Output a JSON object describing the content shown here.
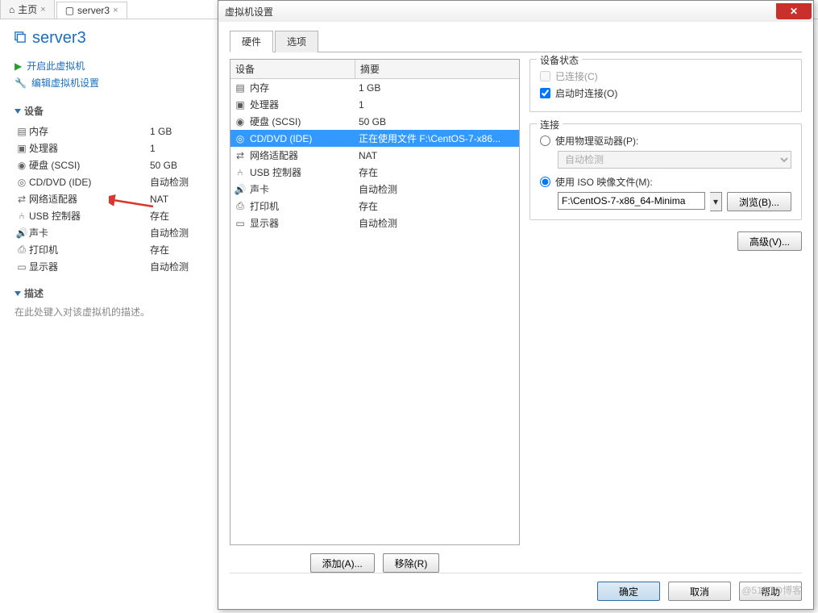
{
  "topTabs": [
    {
      "label": "主页",
      "icon": "home"
    },
    {
      "label": "server3",
      "icon": "vm",
      "active": true
    }
  ],
  "vm": {
    "name": "server3",
    "actions": {
      "start": "开启此虚拟机",
      "edit": "编辑虚拟机设置"
    }
  },
  "leftSections": {
    "devicesTitle": "设备",
    "devices": [
      {
        "name": "内存",
        "value": "1 GB",
        "icon": "memory"
      },
      {
        "name": "处理器",
        "value": "1",
        "icon": "cpu"
      },
      {
        "name": "硬盘 (SCSI)",
        "value": "50 GB",
        "icon": "disk"
      },
      {
        "name": "CD/DVD (IDE)",
        "value": "自动检测",
        "icon": "cd"
      },
      {
        "name": "网络适配器",
        "value": "NAT",
        "icon": "net"
      },
      {
        "name": "USB 控制器",
        "value": "存在",
        "icon": "usb"
      },
      {
        "name": "声卡",
        "value": "自动检测",
        "icon": "sound"
      },
      {
        "name": "打印机",
        "value": "存在",
        "icon": "printer"
      },
      {
        "name": "显示器",
        "value": "自动检测",
        "icon": "display"
      }
    ],
    "descTitle": "描述",
    "descPlaceholder": "在此处键入对该虚拟机的描述。"
  },
  "dialog": {
    "title": "虚拟机设置",
    "tabs": {
      "hardware": "硬件",
      "options": "选项"
    },
    "hwHeaders": {
      "device": "设备",
      "summary": "摘要"
    },
    "hwList": [
      {
        "name": "内存",
        "summary": "1 GB",
        "icon": "memory"
      },
      {
        "name": "处理器",
        "summary": "1",
        "icon": "cpu"
      },
      {
        "name": "硬盘 (SCSI)",
        "summary": "50 GB",
        "icon": "disk"
      },
      {
        "name": "CD/DVD (IDE)",
        "summary": "正在使用文件 F:\\CentOS-7-x86...",
        "icon": "cd",
        "selected": true
      },
      {
        "name": "网络适配器",
        "summary": "NAT",
        "icon": "net"
      },
      {
        "name": "USB 控制器",
        "summary": "存在",
        "icon": "usb"
      },
      {
        "name": "声卡",
        "summary": "自动检测",
        "icon": "sound"
      },
      {
        "name": "打印机",
        "summary": "存在",
        "icon": "printer"
      },
      {
        "name": "显示器",
        "summary": "自动检测",
        "icon": "display"
      }
    ],
    "btns": {
      "add": "添加(A)...",
      "remove": "移除(R)"
    },
    "status": {
      "legend": "设备状态",
      "connected": "已连接(C)",
      "connectAtPowerOn": "启动时连接(O)"
    },
    "connection": {
      "legend": "连接",
      "physical": "使用物理驱动器(P):",
      "autodetect": "自动检测",
      "iso": "使用 ISO 映像文件(M):",
      "isoPath": "F:\\CentOS-7-x86_64-Minima",
      "browse": "浏览(B)..."
    },
    "advanced": "高级(V)...",
    "footer": {
      "ok": "确定",
      "cancel": "取消",
      "help": "帮助"
    }
  },
  "watermark": "@51CTO博客"
}
